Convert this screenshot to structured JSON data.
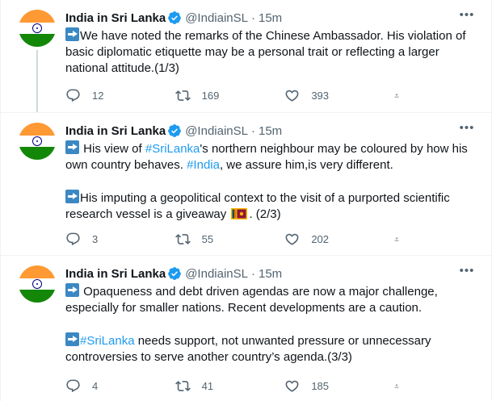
{
  "account": {
    "name": "India in Sri Lanka",
    "handle": "@IndiainSL",
    "separator": "·",
    "time": "15m"
  },
  "tweets": [
    {
      "paragraphs": [
        {
          "arrow": true,
          "parts": [
            {
              "t": "We have noted the remarks of the Chinese Ambassador. His violation of basic diplomatic etiquette may be a personal trait or reflecting a larger national attitude.(1/3)"
            }
          ]
        }
      ],
      "replies": "12",
      "retweets": "169",
      "likes": "393"
    },
    {
      "paragraphs": [
        {
          "arrow": true,
          "parts": [
            {
              "t": " His view of "
            },
            {
              "t": "#SriLanka",
              "tag": true
            },
            {
              "t": "'s northern neighbour may be coloured by how his own country behaves. "
            },
            {
              "t": "#India",
              "tag": true
            },
            {
              "t": ", we assure him,is very different."
            }
          ]
        },
        {
          "arrow": true,
          "parts": [
            {
              "t": "His imputing a geopolitical context to the visit of a purported scientific research vessel is a giveaway "
            },
            {
              "flag": "sri-lanka-flag"
            },
            {
              "t": ". (2/3)"
            }
          ]
        }
      ],
      "replies": "3",
      "retweets": "55",
      "likes": "202"
    },
    {
      "paragraphs": [
        {
          "arrow": true,
          "parts": [
            {
              "t": " Opaqueness and debt driven agendas are now a major challenge, especially for smaller nations. Recent developments are a caution."
            }
          ]
        },
        {
          "arrow": true,
          "parts": [
            {
              "t": "#SriLanka",
              "tag": true
            },
            {
              "t": " needs support, not unwanted pressure or unnecessary controversies to serve another country’s agenda.(3/3)"
            }
          ]
        }
      ],
      "replies": "4",
      "retweets": "41",
      "likes": "185"
    }
  ],
  "icons": {
    "avatar": "india-flag-avatar",
    "verified": "verified-badge-icon",
    "more": "more-options-icon",
    "reply": "reply-icon",
    "retweet": "retweet-icon",
    "like": "heart-icon",
    "share": "share-icon",
    "arrow": "right-arrow-emoji-icon"
  },
  "colors": {
    "accent": "#1d9bf0",
    "muted": "#536471",
    "saffron": "#ff9933",
    "green": "#138808",
    "chakra": "#000080"
  }
}
